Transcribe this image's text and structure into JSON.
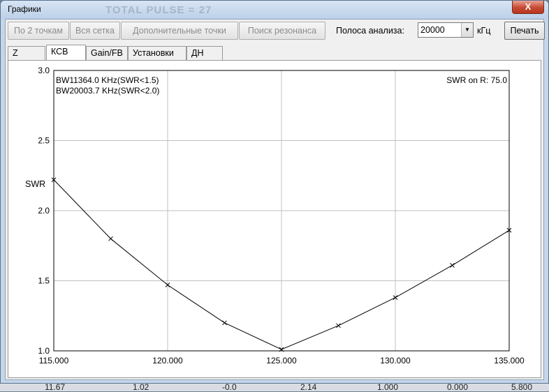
{
  "window": {
    "title": "Графики",
    "behind_title": "TOTAL PULSE = 27",
    "close_label": "X"
  },
  "toolbar": {
    "btn_two_points": "По 2 точкам",
    "btn_all_grid": "Вся сетка",
    "btn_extra_points": "Дополнительные точки",
    "btn_find_resonance": "Поиск резонанса",
    "band_label": "Полоса анализа:",
    "band_value": "20000",
    "band_unit": "кГц",
    "print_label": "Печать"
  },
  "tabs": [
    {
      "label": "Z"
    },
    {
      "label": "КСВ"
    },
    {
      "label": "Gain/FB"
    },
    {
      "label": "Установки"
    },
    {
      "label": "ДН"
    }
  ],
  "active_tab": "КСВ",
  "background_row": [
    "11.67",
    "1.02",
    "-0.0",
    "2.14",
    "1.000",
    "0.000",
    "5.800"
  ],
  "chart_data": {
    "type": "line",
    "x": [
      115.0,
      117.5,
      120.0,
      122.5,
      125.0,
      127.5,
      130.0,
      132.5,
      135.0
    ],
    "y": [
      2.22,
      1.8,
      1.47,
      1.2,
      1.01,
      1.18,
      1.38,
      1.61,
      1.86
    ],
    "xlim": [
      115.0,
      135.0
    ],
    "ylim": [
      1.0,
      3.0
    ],
    "x_ticks": [
      "115.000",
      "120.000",
      "125.000",
      "130.000",
      "135.000"
    ],
    "y_ticks": [
      "1.0",
      "1.5",
      "2.0",
      "2.5",
      "3.0"
    ],
    "ylabel": "SWR",
    "annotations": [
      "BW11364.0 KHz(SWR<1.5)",
      "BW20003.7 KHz(SWR<2.0)"
    ],
    "reference_label": "SWR on R: 75.0",
    "marker": "x",
    "grid": true,
    "line_color": "#000000",
    "grid_color": "#c0c0c0"
  }
}
